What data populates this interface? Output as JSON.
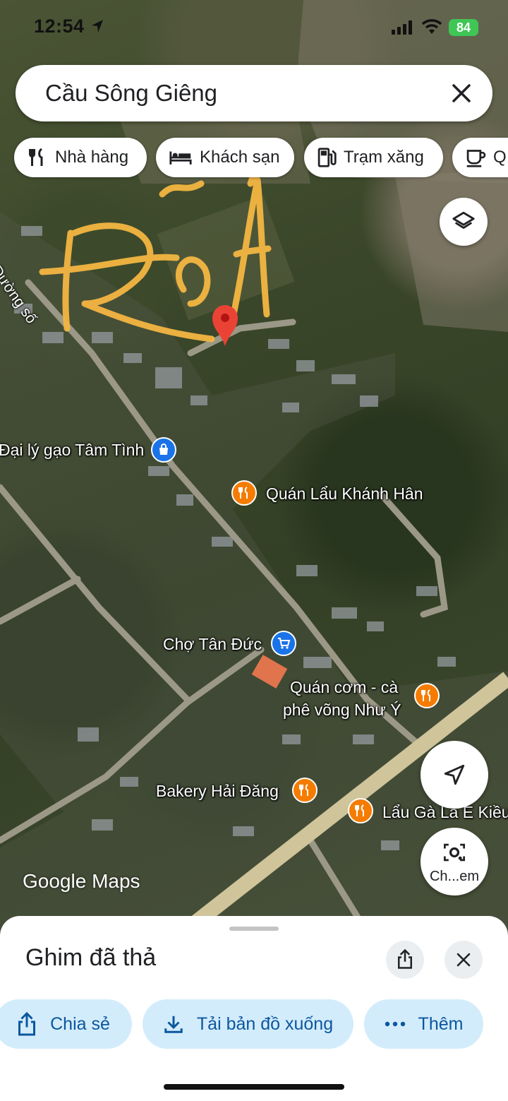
{
  "status_bar": {
    "time": "12:54",
    "battery": "84",
    "icons": [
      "location-arrow-icon",
      "signal-icon",
      "wifi-icon",
      "battery-icon"
    ]
  },
  "search": {
    "query": "Cầu Sông Giêng",
    "clear_icon": "close-icon"
  },
  "chips": [
    {
      "label": "Nhà hàng",
      "icon": "restaurant-icon"
    },
    {
      "label": "Khách sạn",
      "icon": "hotel-icon"
    },
    {
      "label": "Trạm xăng",
      "icon": "gas-station-icon"
    },
    {
      "label": "Q",
      "icon": "coffee-icon"
    }
  ],
  "map": {
    "road_label": "Đường số",
    "pois": [
      {
        "name": "Đại lý gạo Tâm Tình",
        "icon": "shopping-bag-icon",
        "color": "#1a73e8"
      },
      {
        "name": "Quán Lẩu Khánh Hân",
        "icon": "restaurant-icon",
        "color": "#f57c00"
      },
      {
        "name": "Chợ Tân Đức",
        "icon": "shopping-cart-icon",
        "color": "#1a73e8"
      },
      {
        "name_line1": "Quán cơm - cà",
        "name_line2": "phê võng Như Ý",
        "icon": "restaurant-icon",
        "color": "#f57c00"
      },
      {
        "name": "Bakery Hải Đăng",
        "icon": "restaurant-icon",
        "color": "#f57c00"
      },
      {
        "name": "Lẩu Gà La E Kiều",
        "icon": "restaurant-icon",
        "color": "#f57c00"
      }
    ],
    "pin_color": "#ea4335",
    "annotation_color": "#f4b642",
    "watermark": "Google Maps"
  },
  "buttons": {
    "layers_icon": "layers-icon",
    "navigate_icon": "navigate-icon",
    "lens_label": "Ch...em"
  },
  "sheet": {
    "title": "Ghim đã thả",
    "actions": [
      {
        "label": "Chia sẻ",
        "icon": "share-icon"
      },
      {
        "label": "Tải bản đồ xuống",
        "icon": "download-icon"
      },
      {
        "label": "Thêm",
        "icon": "more-icon"
      }
    ]
  }
}
